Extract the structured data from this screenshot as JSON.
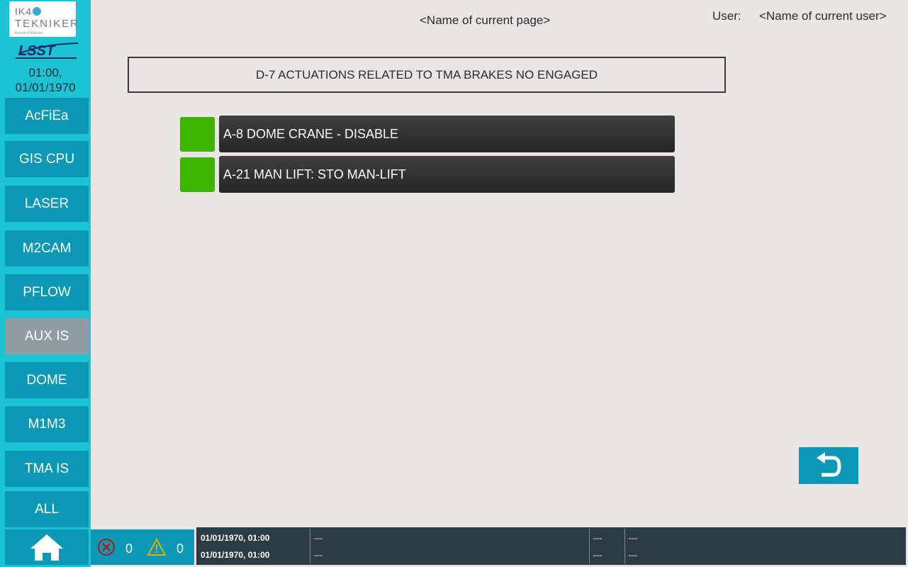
{
  "logo": {
    "line1": "IK4",
    "line2": "TEKNIKER",
    "line3": "Research Alliance",
    "lsst": "LSST"
  },
  "clock": {
    "time": "01:00,",
    "date": "01/01/1970"
  },
  "nav": [
    {
      "label": "AcFiEa",
      "active": false
    },
    {
      "label": "GIS CPU",
      "active": false
    },
    {
      "label": "LASER",
      "active": false
    },
    {
      "label": "M2CAM",
      "active": false
    },
    {
      "label": "PFLOW",
      "active": false
    },
    {
      "label": "AUX IS",
      "active": true
    },
    {
      "label": "DOME",
      "active": false
    },
    {
      "label": "M1M3",
      "active": false
    },
    {
      "label": "TMA IS",
      "active": false
    },
    {
      "label": "ALL",
      "active": false
    }
  ],
  "header": {
    "page_name": "<Name of current page>",
    "user_label": "User:",
    "user_name": "<Name of current user>"
  },
  "section": {
    "title": "D-7 ACTUATIONS RELATED TO TMA BRAKES NO ENGAGED"
  },
  "actuations": [
    {
      "label": "A-8 DOME CRANE - DISABLE",
      "status_color": "#3db500"
    },
    {
      "label": "A-21 MAN LIFT: STO MAN-LIFT",
      "status_color": "#3db500"
    }
  ],
  "footer": {
    "error_count": "0",
    "warning_count": "0",
    "log": {
      "timestamps": [
        "01/01/1970, 01:00",
        "01/01/1970, 01:00"
      ],
      "col2": [
        "---",
        "---"
      ],
      "col3": [
        "---",
        "---"
      ],
      "col4": [
        "---",
        "---"
      ]
    }
  },
  "colors": {
    "sidebar": "#1cc3d2",
    "button": "#0b98b5",
    "active_button": "#8f9ca2",
    "ok_indicator": "#3db500",
    "footer_log_bg": "#2d3b45"
  }
}
